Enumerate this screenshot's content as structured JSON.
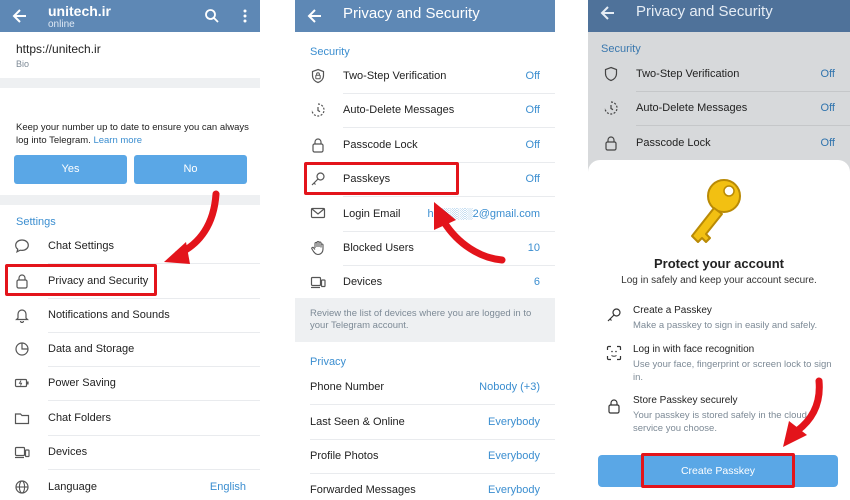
{
  "panel1": {
    "header": {
      "title": "unitech.ir",
      "subtitle": "online"
    },
    "bio": {
      "value": "https://unitech.ir",
      "label": "Bio"
    },
    "number_prompt": {
      "text": "Keep your number up to date to ensure you can always log into Telegram.",
      "link": "Learn more",
      "yes": "Yes",
      "no": "No"
    },
    "settings_title": "Settings",
    "items": [
      {
        "label": "Chat Settings",
        "icon": "chat-icon"
      },
      {
        "label": "Privacy and Security",
        "icon": "lock-icon"
      },
      {
        "label": "Notifications and Sounds",
        "icon": "bell-icon"
      },
      {
        "label": "Data and Storage",
        "icon": "pie-chart-icon"
      },
      {
        "label": "Power Saving",
        "icon": "battery-icon"
      },
      {
        "label": "Chat Folders",
        "icon": "folder-icon"
      },
      {
        "label": "Devices",
        "icon": "devices-icon"
      },
      {
        "label": "Language",
        "icon": "globe-icon",
        "value": "English"
      }
    ]
  },
  "panel2": {
    "header": {
      "title": "Privacy and Security"
    },
    "security_title": "Security",
    "security_items": [
      {
        "label": "Two-Step Verification",
        "value": "Off",
        "icon": "shield-icon"
      },
      {
        "label": "Auto-Delete Messages",
        "value": "Off",
        "icon": "timer-icon"
      },
      {
        "label": "Passcode Lock",
        "value": "Off",
        "icon": "lock-icon"
      },
      {
        "label": "Passkeys",
        "value": "Off",
        "icon": "key-icon"
      },
      {
        "label": "Login Email",
        "value": "h░░░░░2@gmail.com",
        "icon": "mail-icon"
      },
      {
        "label": "Blocked Users",
        "value": "10",
        "icon": "hand-icon"
      },
      {
        "label": "Devices",
        "value": "6",
        "icon": "devices-icon"
      }
    ],
    "devices_note": "Review the list of devices where you are logged in to your Telegram account.",
    "privacy_title": "Privacy",
    "privacy_items": [
      {
        "label": "Phone Number",
        "value": "Nobody (+3)"
      },
      {
        "label": "Last Seen & Online",
        "value": "Everybody"
      },
      {
        "label": "Profile Photos",
        "value": "Everybody"
      },
      {
        "label": "Forwarded Messages",
        "value": "Everybody"
      }
    ]
  },
  "panel3": {
    "header": {
      "title": "Privacy and Security"
    },
    "security_title": "Security",
    "items": [
      {
        "label": "Two-Step Verification",
        "value": "Off"
      },
      {
        "label": "Auto-Delete Messages",
        "value": "Off"
      },
      {
        "label": "Passcode Lock",
        "value": "Off"
      }
    ],
    "sheet": {
      "title": "Protect your account",
      "subtitle": "Log in safely and keep your account secure.",
      "features": [
        {
          "title": "Create a Passkey",
          "desc": "Make a passkey to sign in easily and safely.",
          "icon": "key-icon"
        },
        {
          "title": "Log in with face recognition",
          "desc": "Use your face, fingerprint or screen lock to sign in.",
          "icon": "face-id-icon"
        },
        {
          "title": "Store Passkey securely",
          "desc": "Your passkey is stored safely in the cloud service you choose.",
          "icon": "lock-icon"
        }
      ],
      "button": "Create Passkey"
    }
  },
  "colors": {
    "header": "#5e88b5",
    "accent": "#3b8ed0",
    "button": "#5aa7e6",
    "highlight": "#e3141b",
    "key": "#f2c012"
  }
}
